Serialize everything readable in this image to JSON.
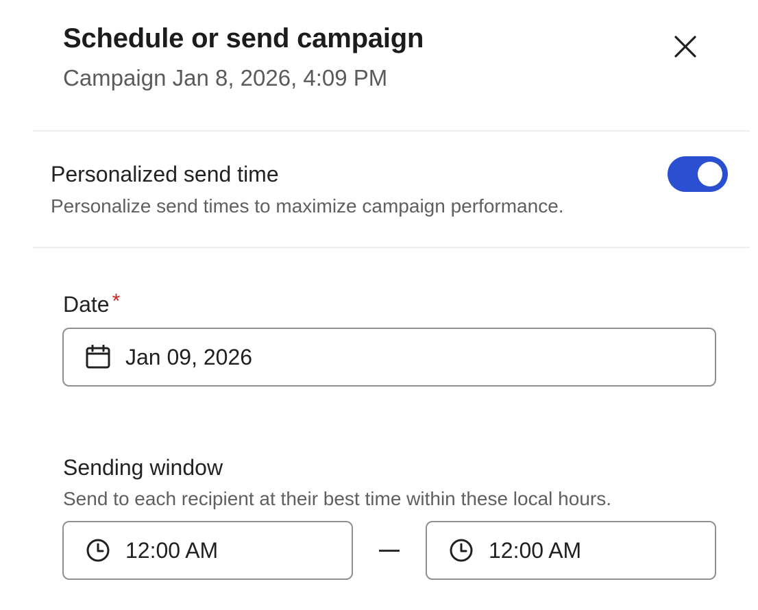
{
  "dialog": {
    "title": "Schedule or send campaign",
    "subtitle": "Campaign Jan 8, 2026, 4:09 PM",
    "close_icon": "close-icon"
  },
  "personalized_send": {
    "title": "Personalized send time",
    "description": "Personalize send times to maximize campaign performance.",
    "enabled": true,
    "accent_color": "#2a4fd0"
  },
  "date_field": {
    "label": "Date",
    "required_marker": "*",
    "value": "Jan 09, 2026",
    "icon": "calendar-icon"
  },
  "sending_window": {
    "label": "Sending window",
    "description": "Send to each recipient at their best time within these local hours.",
    "start": {
      "value": "12:00 AM",
      "icon": "clock-icon"
    },
    "end": {
      "value": "12:00 AM",
      "icon": "clock-icon"
    }
  }
}
